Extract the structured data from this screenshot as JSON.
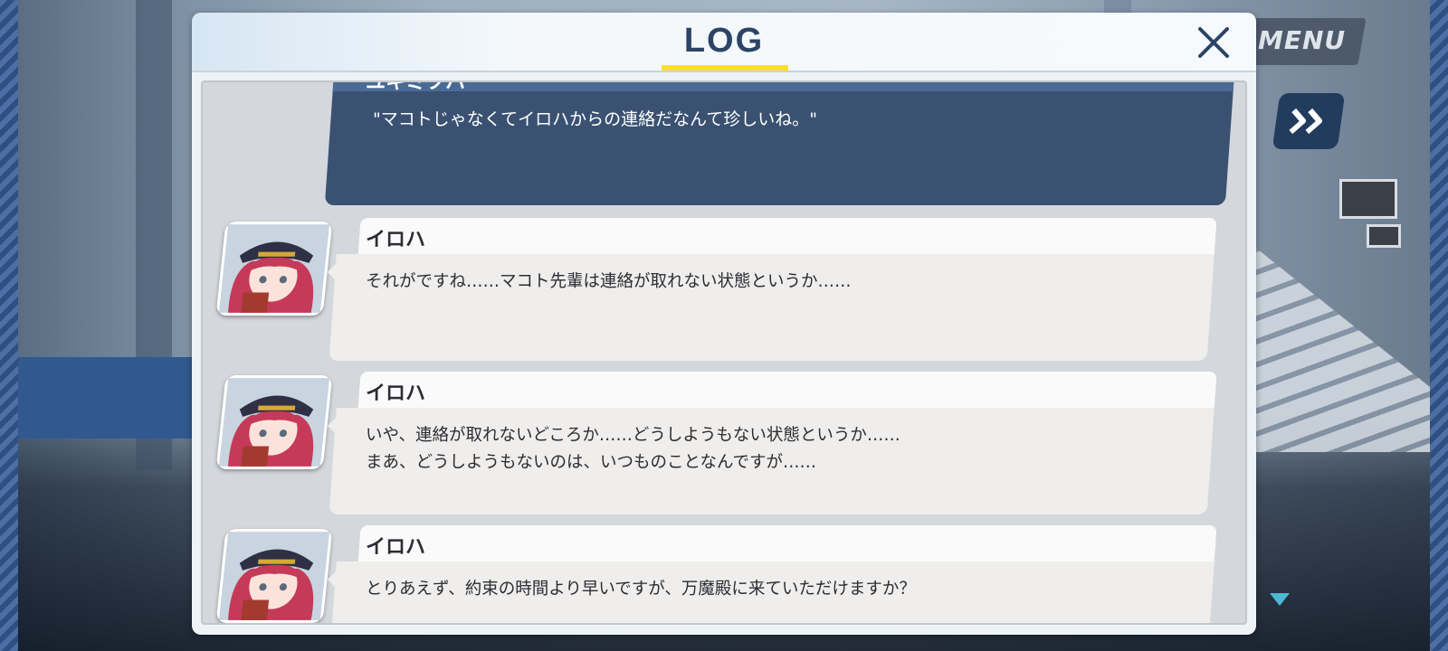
{
  "hud": {
    "menu_label": "MENU",
    "fast_forward_icon": "double-chevron-right-icon"
  },
  "log": {
    "title": "LOG",
    "close_icon": "close-icon",
    "entries": [
      {
        "speaker": "ユキミツハ",
        "lines": [
          "\"マコトじゃなくてイロハからの連絡だなんて珍しいね。\""
        ],
        "is_player": true
      },
      {
        "speaker": "イロハ",
        "lines": [
          "それがですね……マコト先輩は連絡が取れない状態というか……"
        ],
        "is_player": false
      },
      {
        "speaker": "イロハ",
        "lines": [
          "いや、連絡が取れないどころか……どうしようもない状態というか……",
          "まあ、どうしようもないのは、いつものことなんですが……"
        ],
        "is_player": false
      },
      {
        "speaker": "イロハ",
        "lines": [
          "とりあえず、約束の時間より早いですが、万魔殿に来ていただけますか？"
        ],
        "is_player": false
      }
    ]
  },
  "colors": {
    "accent_underline": "#ffdf2e",
    "title_text": "#2b4466",
    "player_bubble": "#3a5172",
    "npc_bubble": "#efeeec",
    "scroll_indicator": "#4fb7d6"
  }
}
